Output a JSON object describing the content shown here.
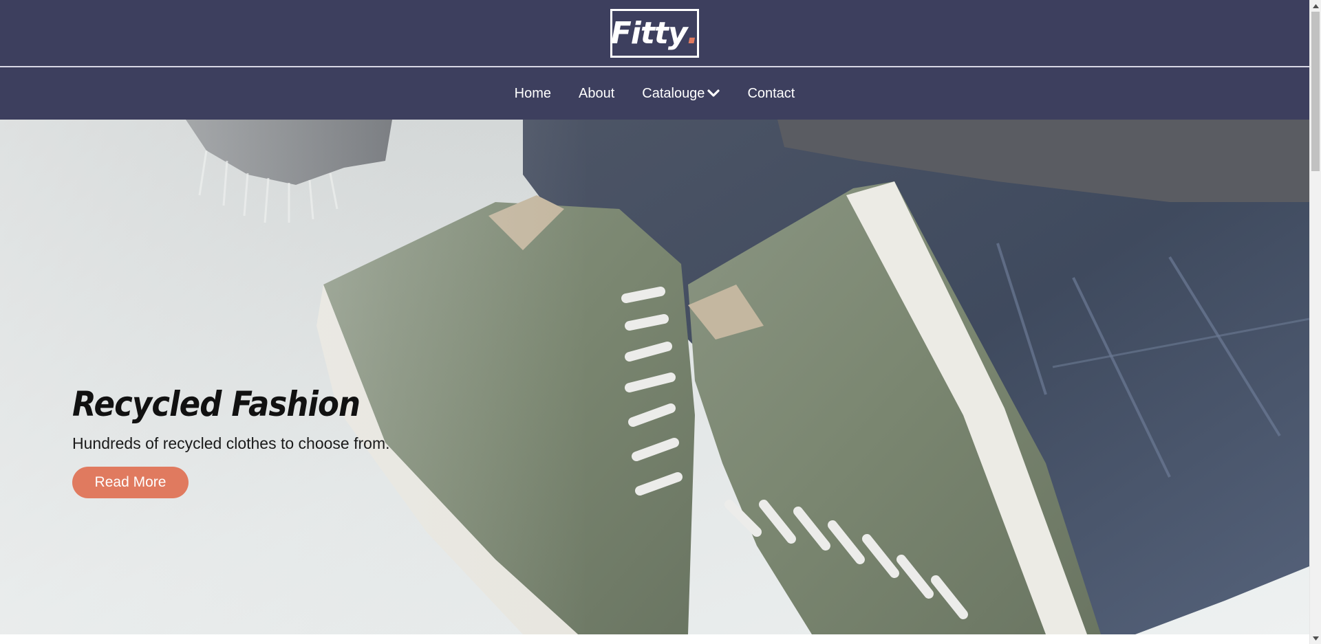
{
  "brand": {
    "name": "Fitty",
    "dot": ".",
    "accent_color": "#e07a5f",
    "header_color": "#3d3f5e"
  },
  "nav": {
    "items": [
      {
        "label": "Home"
      },
      {
        "label": "About"
      },
      {
        "label": "Catalouge",
        "icon": "chevron-down-icon"
      },
      {
        "label": "Contact"
      }
    ]
  },
  "hero": {
    "title": "Recycled Fashion",
    "subtitle": "Hundreds of recycled clothes to choose from.",
    "button_label": "Read More"
  }
}
